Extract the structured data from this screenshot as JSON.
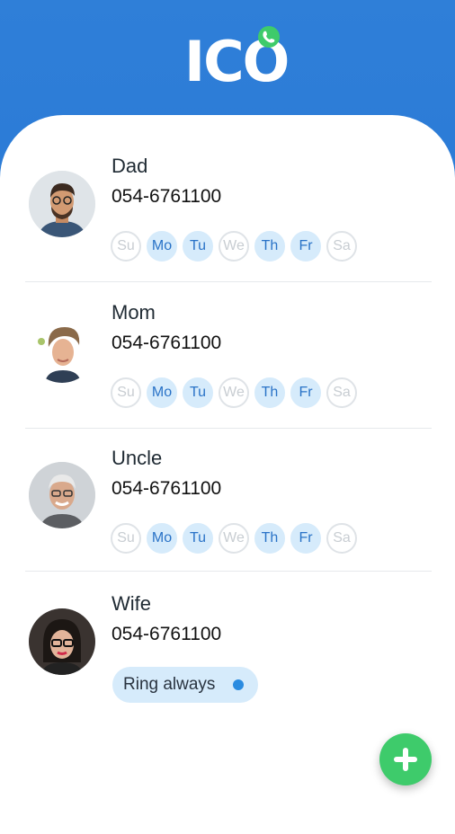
{
  "app": {
    "logo_text": "ICO"
  },
  "contacts": [
    {
      "name": "Dad",
      "phone": "054-6761100",
      "avatar": "avatar-dad",
      "days": [
        {
          "label": "Su",
          "on": false
        },
        {
          "label": "Mo",
          "on": true
        },
        {
          "label": "Tu",
          "on": true
        },
        {
          "label": "We",
          "on": false
        },
        {
          "label": "Th",
          "on": true
        },
        {
          "label": "Fr",
          "on": true
        },
        {
          "label": "Sa",
          "on": false
        }
      ]
    },
    {
      "name": "Mom",
      "phone": "054-6761100",
      "avatar": "avatar-mom",
      "days": [
        {
          "label": "Su",
          "on": false
        },
        {
          "label": "Mo",
          "on": true
        },
        {
          "label": "Tu",
          "on": true
        },
        {
          "label": "We",
          "on": false
        },
        {
          "label": "Th",
          "on": true
        },
        {
          "label": "Fr",
          "on": true
        },
        {
          "label": "Sa",
          "on": false
        }
      ]
    },
    {
      "name": "Uncle",
      "phone": "054-6761100",
      "avatar": "avatar-uncle",
      "days": [
        {
          "label": "Su",
          "on": false
        },
        {
          "label": "Mo",
          "on": true
        },
        {
          "label": "Tu",
          "on": true
        },
        {
          "label": "We",
          "on": false
        },
        {
          "label": "Th",
          "on": true
        },
        {
          "label": "Fr",
          "on": true
        },
        {
          "label": "Sa",
          "on": false
        }
      ]
    },
    {
      "name": "Wife",
      "phone": "054-6761100",
      "avatar": "avatar-wife",
      "ring_always_label": "Ring always"
    }
  ],
  "colors": {
    "header": "#2f7fd8",
    "day_on_bg": "#d6ebfb",
    "day_on_text": "#2a73c7",
    "fab": "#3ecb6b"
  },
  "icons": {
    "logo_badge": "phone-icon",
    "fab": "plus-icon"
  }
}
